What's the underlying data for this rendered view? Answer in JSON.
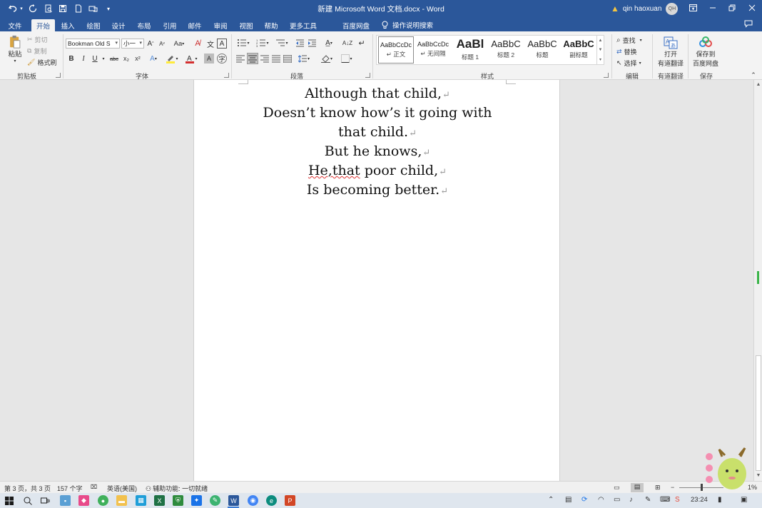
{
  "window": {
    "title": "新建 Microsoft Word 文档.docx  -  Word",
    "user_name": "qin haoxuan",
    "user_initials": "QH"
  },
  "quick_access": {
    "undo_icon": "undo-icon",
    "redo_icon": "redo-icon",
    "save_icon": "save-icon"
  },
  "tabs": [
    "文件",
    "开始",
    "插入",
    "绘图",
    "设计",
    "布局",
    "引用",
    "邮件",
    "审阅",
    "视图",
    "帮助",
    "更多工具",
    "百度网盘"
  ],
  "active_tab": "开始",
  "tell_me": "操作说明搜索",
  "ribbon": {
    "clipboard": {
      "paste": "粘贴",
      "cut": "剪切",
      "copy": "复制",
      "format_painter": "格式刷",
      "label": "剪贴板"
    },
    "font": {
      "font_name": "Bookman Old S",
      "font_size": "小一",
      "grow": "A",
      "shrink": "A",
      "case": "Aa",
      "bold": "B",
      "italic": "I",
      "underline": "U",
      "strike": "abc",
      "subscript": "x₂",
      "superscript": "x²",
      "label": "字体"
    },
    "paragraph": {
      "label": "段落"
    },
    "styles": {
      "label": "样式",
      "items": [
        {
          "sample": "AaBbCcDc",
          "name": "↵ 正文"
        },
        {
          "sample": "AaBbCcDc",
          "name": "↵ 无间隔"
        },
        {
          "sample": "AaBl",
          "name": "标题 1"
        },
        {
          "sample": "AaBbC",
          "name": "标题 2"
        },
        {
          "sample": "AaBbC",
          "name": "标题"
        },
        {
          "sample": "AaBbC",
          "name": "副标题"
        }
      ]
    },
    "editing": {
      "find": "查找",
      "replace": "替换",
      "select": "选择",
      "label": "编辑"
    },
    "youdao": {
      "open_line1": "打开",
      "open_line2": "有道翻译",
      "label": "有道翻译"
    },
    "baidu": {
      "save_line1": "保存到",
      "save_line2": "百度网盘",
      "label": "保存"
    }
  },
  "document": {
    "lines": [
      "Although that child,",
      "Doesn’t know how’s it going with",
      "that child.",
      "But he knows,",
      "He,that poor child,",
      "Is becoming better."
    ],
    "misspelled_word": "He,that",
    "paragraph_mark": "↵"
  },
  "status": {
    "page": "第 3 页，共 3 页",
    "words": "157 个字",
    "language": "英语(美国)",
    "accessibility": "辅助功能: 一切就绪",
    "zoom": "1%"
  },
  "taskbar": {
    "time": "23:24"
  }
}
